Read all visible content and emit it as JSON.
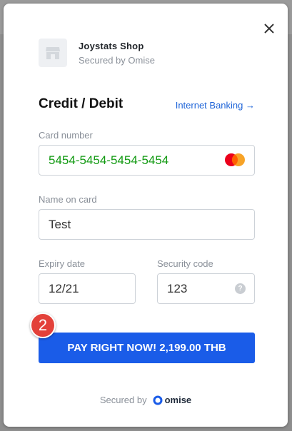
{
  "shop": {
    "name": "Joystats Shop",
    "secured_by": "Secured by Omise",
    "logo_icon": "storefront-icon"
  },
  "close_icon": "close-icon",
  "form": {
    "title": "Credit / Debit",
    "switch_link": "Internet Banking →",
    "card_number": {
      "label": "Card number",
      "value": "5454-5454-5454-5454",
      "brand_icon": "mastercard-icon"
    },
    "name_on_card": {
      "label": "Name on card",
      "value": "Test"
    },
    "expiry": {
      "label": "Expiry date",
      "value": "12/21"
    },
    "security": {
      "label": "Security code",
      "value": "123",
      "help_icon": "question-icon",
      "help_glyph": "?"
    }
  },
  "pay_button": {
    "label": "PAY RIGHT NOW! 2,199.00 THB"
  },
  "step_badge": {
    "number": "2"
  },
  "footer": {
    "secured_by": "Secured by",
    "brand": "omise"
  },
  "colors": {
    "accent": "#1a5ce8",
    "link": "#1e64d8",
    "valid_text": "#129a12",
    "badge": "#e3413a"
  }
}
